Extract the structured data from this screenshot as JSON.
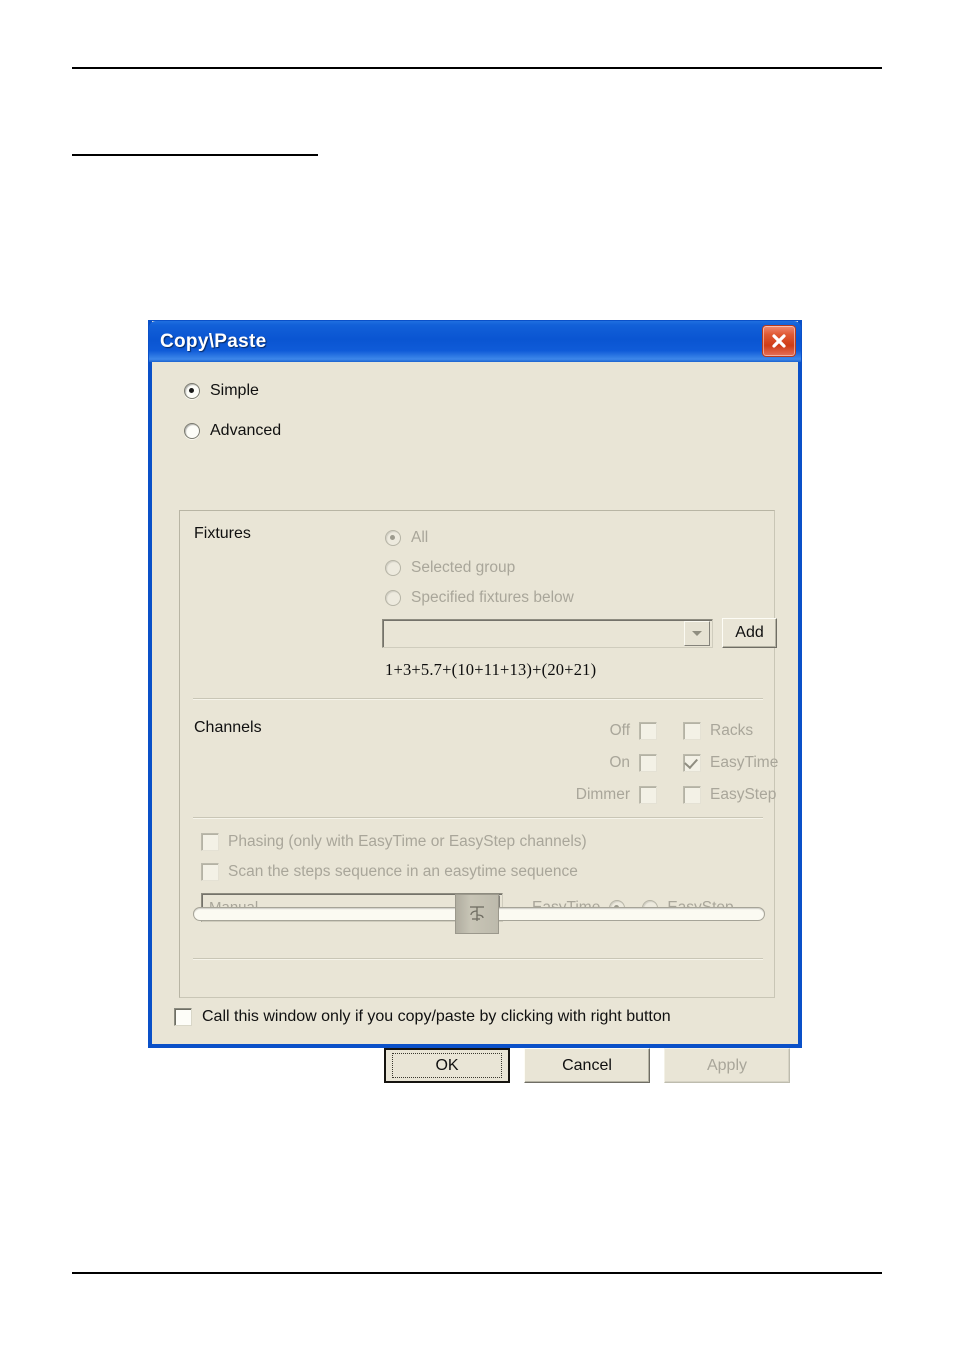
{
  "page": {
    "rules": [
      "top-rule",
      "sub-rule",
      "bottom-rule"
    ]
  },
  "dialog": {
    "title": "Copy\\Paste",
    "close_icon": "close-icon",
    "mode": {
      "simple_label": "Simple",
      "advanced_label": "Advanced",
      "selected": "Simple"
    },
    "fixtures": {
      "section_label": "Fixtures",
      "options": [
        {
          "label": "All",
          "selected": true,
          "disabled": true
        },
        {
          "label": "Selected group",
          "selected": false,
          "disabled": true
        },
        {
          "label": "Specified fixtures below",
          "selected": false,
          "disabled": true
        }
      ],
      "combo_value": "",
      "combo_placeholder": "",
      "add_button_label": "Add",
      "expression": "1+3+5.7+(10+11+13)+(20+21)"
    },
    "channels": {
      "section_label": "Channels",
      "rows": [
        {
          "left_label": "Off",
          "left_checked": false,
          "right_label": "Racks",
          "right_checked": false
        },
        {
          "left_label": "On",
          "left_checked": false,
          "right_label": "EasyTime",
          "right_checked": true
        },
        {
          "left_label": "Dimmer",
          "left_checked": false,
          "right_label": "EasyStep",
          "right_checked": false
        }
      ]
    },
    "phasing": {
      "phasing_label": "Phasing (only with EasyTime or EasyStep channels)",
      "phasing_checked": false,
      "scan_label": "Scan the steps sequence in an easytime sequence",
      "scan_checked": false,
      "mode_combo_value": "Manual",
      "easytime_label": "EasyTime",
      "easystep_label": "EasyStep",
      "selected_engine": "EasyTime",
      "slider_value": 46
    },
    "bottom": {
      "call_window_label": "Call this window only if you copy/paste by clicking with right button",
      "call_window_checked": false
    },
    "buttons": {
      "ok": "OK",
      "cancel": "Cancel",
      "apply": "Apply"
    },
    "colors": {
      "titlebar_blue": "#0a55d2",
      "window_border": "#0a50c8",
      "dialog_background": "#e9e5d6",
      "close_red": "#cf3c16",
      "disabled_text": "#a9a69a",
      "enabled_text": "#101010"
    }
  }
}
